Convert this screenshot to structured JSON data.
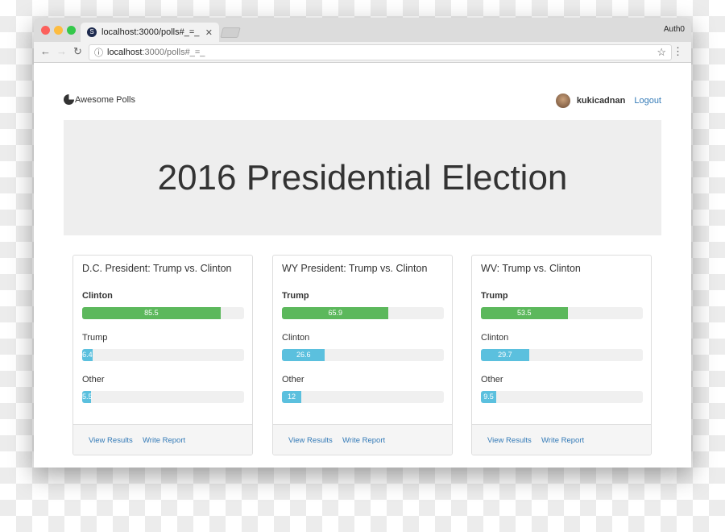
{
  "browser": {
    "tab_title": "localhost:3000/polls#_=_",
    "profile": "Auth0",
    "url_host": "localhost",
    "url_path": ":3000/polls#_=_"
  },
  "header": {
    "brand": "Awesome Polls",
    "username": "kukicadnan",
    "logout": "Logout"
  },
  "jumbotron": {
    "title": "2016 Presidential Election"
  },
  "colors": {
    "leader": "#5cb85c",
    "other": "#5bc0de",
    "link": "#337ab7"
  },
  "polls": [
    {
      "title": "D.C. President: Trump vs. Clinton",
      "options": [
        {
          "label": "Clinton",
          "value": 85.5,
          "leader": true
        },
        {
          "label": "Trump",
          "value": 6.4
        },
        {
          "label": "Other",
          "value": 5.5
        }
      ],
      "view": "View Results",
      "write": "Write Report"
    },
    {
      "title": "WY President: Trump vs. Clinton",
      "options": [
        {
          "label": "Trump",
          "value": 65.9,
          "leader": true
        },
        {
          "label": "Clinton",
          "value": 26.6
        },
        {
          "label": "Other",
          "value": 12
        }
      ],
      "view": "View Results",
      "write": "Write Report"
    },
    {
      "title": "WV: Trump vs. Clinton",
      "options": [
        {
          "label": "Trump",
          "value": 53.5,
          "leader": true
        },
        {
          "label": "Clinton",
          "value": 29.7
        },
        {
          "label": "Other",
          "value": 9.5
        }
      ],
      "view": "View Results",
      "write": "Write Report"
    }
  ]
}
